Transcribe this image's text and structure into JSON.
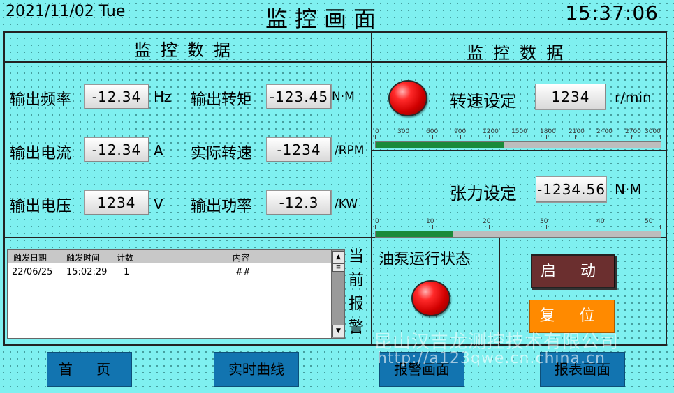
{
  "header": {
    "date": "2021/11/02 Tue",
    "title": "监控画面",
    "time": "15:37:06"
  },
  "left_panel": {
    "title": "监控数据",
    "fields": [
      {
        "label": "输出频率",
        "value": "-12.34",
        "unit": "Hz"
      },
      {
        "label": "输出转矩",
        "value": "-123.45",
        "unit": "N·M"
      },
      {
        "label": "输出电流",
        "value": "-12.34",
        "unit": "A"
      },
      {
        "label": "实际转速",
        "value": "-1234",
        "unit": "/RPM"
      },
      {
        "label": "输出电压",
        "value": "1234",
        "unit": "V"
      },
      {
        "label": "输出功率",
        "value": "-12.3",
        "unit": "/KW"
      }
    ]
  },
  "right_panel": {
    "title": "监控数据",
    "speed": {
      "label": "转速设定",
      "value": "1234",
      "unit": "r/min",
      "scale": [
        "0",
        "300",
        "600",
        "900",
        "1200",
        "1500",
        "1800",
        "2100",
        "2400",
        "2700",
        "3000"
      ],
      "level": 0.45
    },
    "tension": {
      "label": "张力设定",
      "value": "-1234.56",
      "unit": "N·M",
      "scale": [
        "0",
        "10",
        "20",
        "30",
        "40",
        "50"
      ],
      "level": 0.27
    }
  },
  "alarm": {
    "columns": [
      "触发日期",
      "触发时间",
      "计数",
      "内容"
    ],
    "rows": [
      {
        "date": "22/06/25",
        "time": "15:02:29",
        "count": "1",
        "content": "##"
      }
    ],
    "side_label": [
      "当",
      "前",
      "报",
      "警"
    ]
  },
  "pump": {
    "label": "油泵运行状态"
  },
  "controls": {
    "start": "启 动",
    "reset": "复 位"
  },
  "nav": {
    "home": "首 页",
    "curve": "实时曲线",
    "alarm": "报警画面",
    "report": "报表画面"
  },
  "watermark": {
    "company": "昆山汉吉龙测控技术有限公司",
    "url": "http://a123qwe.cn.china.cn"
  },
  "colors": {
    "background": "#7ff0f0",
    "nav_button": "#1274b0",
    "start_button": "#6b2f2f",
    "reset_button": "#ff8a00",
    "lamp": "#e00000",
    "bar_fill": "#1a8a3a"
  }
}
